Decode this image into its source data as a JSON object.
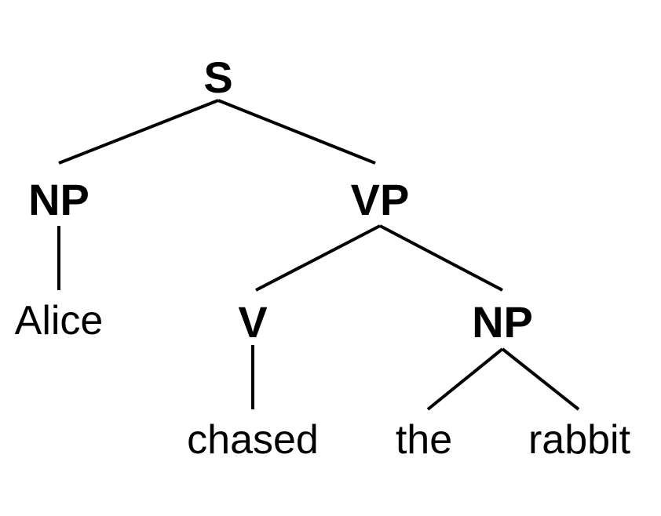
{
  "tree": {
    "nodes": {
      "s": "S",
      "np_subject": "NP",
      "vp": "VP",
      "alice": "Alice",
      "v": "V",
      "np_object": "NP",
      "chased": "chased",
      "the": "the",
      "rabbit": "rabbit"
    }
  }
}
